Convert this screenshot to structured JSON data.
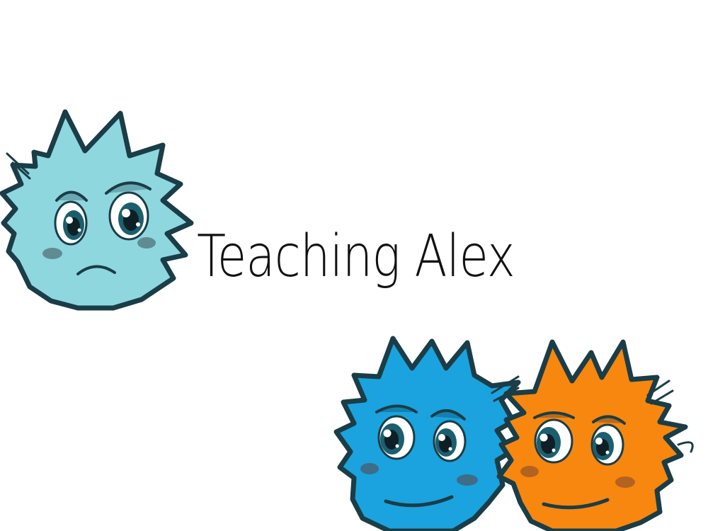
{
  "slide": {
    "title": "Teaching Alex"
  },
  "mascots": [
    {
      "name": "sad-light-blue-creature",
      "body_color": "#8fd7df",
      "mood": "sad"
    },
    {
      "name": "smiling-blue-creature",
      "body_color": "#1aa3de",
      "mood": "smile"
    },
    {
      "name": "smiling-orange-creature",
      "body_color": "#f7870f",
      "mood": "smile"
    }
  ],
  "colors": {
    "background": "#ffffff",
    "outline": "#1a3d47",
    "text": "#111111"
  }
}
